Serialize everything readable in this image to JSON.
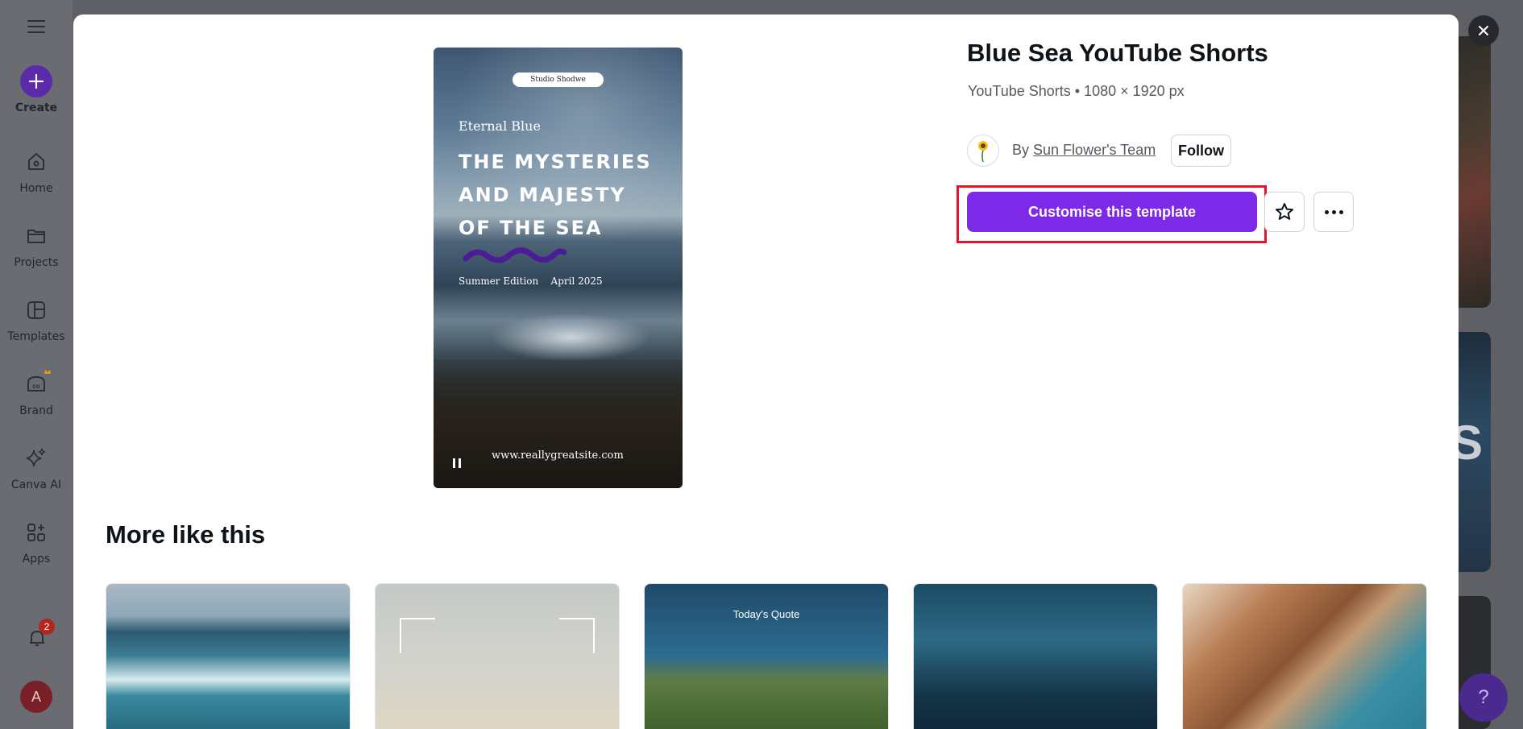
{
  "sidebar": {
    "items": [
      {
        "label": "Create"
      },
      {
        "label": "Home"
      },
      {
        "label": "Projects"
      },
      {
        "label": "Templates"
      },
      {
        "label": "Brand"
      },
      {
        "label": "Canva AI"
      },
      {
        "label": "Apps"
      }
    ],
    "notifications_count": "2",
    "avatar_initial": "A"
  },
  "template": {
    "title": "Blue Sea YouTube Shorts",
    "meta": "YouTube Shorts • 1080 × 1920 px",
    "by_prefix": "By",
    "creator": "Sun Flower's Team",
    "follow_label": "Follow",
    "customise_label": "Customise this template"
  },
  "preview": {
    "studio": "Studio Shodwe",
    "subtitle": "Eternal Blue",
    "headline_lines": [
      "THE MYSTERIES",
      "AND MAJESTY",
      "OF THE SEA"
    ],
    "edition": "Summer Edition",
    "date": "April 2025",
    "url": "www.reallygreatsite.com"
  },
  "more": {
    "title": "More like this",
    "card3_text": "Today's Quote"
  },
  "background": {
    "partial_text": "S"
  },
  "help_label": "?",
  "colors": {
    "accent": "#7d2ae8",
    "highlight": "#e0152a"
  }
}
